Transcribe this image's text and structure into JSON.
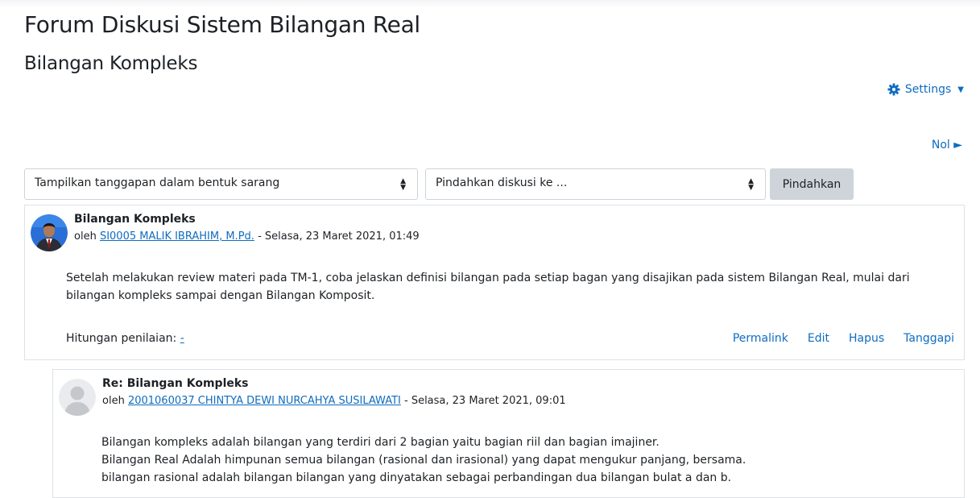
{
  "page": {
    "forum_title": "Forum Diskusi Sistem Bilangan Real",
    "discussion_title": "Bilangan Kompleks"
  },
  "settings": {
    "label": "Settings",
    "icon": "gear-icon"
  },
  "navigation": {
    "next_label": "Nol ►"
  },
  "controls": {
    "display_mode_value": "Tampilkan tanggapan dalam bentuk sarang",
    "move_discussion_value": "Pindahkan diskusi ke ...",
    "move_button_label": "Pindahkan"
  },
  "posts": [
    {
      "subject": "Bilangan Kompleks",
      "by_prefix": "oleh",
      "author": "SI0005 MALIK IBRAHIM, M.Pd.",
      "date": "- Selasa, 23 Maret 2021, 01:49",
      "body": [
        "Setelah melakukan review materi pada TM-1, coba jelaskan definisi bilangan pada setiap bagan yang disajikan pada sistem Bilangan Real, mulai dari bilangan kompleks sampai dengan Bilangan Komposit."
      ],
      "rating_label": "Hitungan penilaian:",
      "rating_value": "-",
      "commands": [
        "Permalink",
        "Edit",
        "Hapus",
        "Tanggapi"
      ]
    },
    {
      "subject": "Re: Bilangan Kompleks",
      "by_prefix": "oleh",
      "author": "2001060037 CHINTYA DEWI NURCAHYA SUSILAWATI",
      "date": "- Selasa, 23 Maret 2021, 09:01",
      "body": [
        "Bilangan kompleks adalah bilangan yang terdiri dari 2 bagian yaitu bagian riil dan bagian imajiner.",
        "Bilangan Real Adalah himpunan semua bilangan (rasional dan irasional) yang dapat mengukur panjang, bersama.",
        "bilangan rasional adalah bilangan bilangan yang dinyatakan sebagai perbandingan dua bilangan bulat a dan b."
      ]
    }
  ],
  "colors": {
    "link": "#0f6cbf",
    "text": "#1d2125",
    "button_bg": "#ced4da",
    "border": "#dee2e6"
  }
}
